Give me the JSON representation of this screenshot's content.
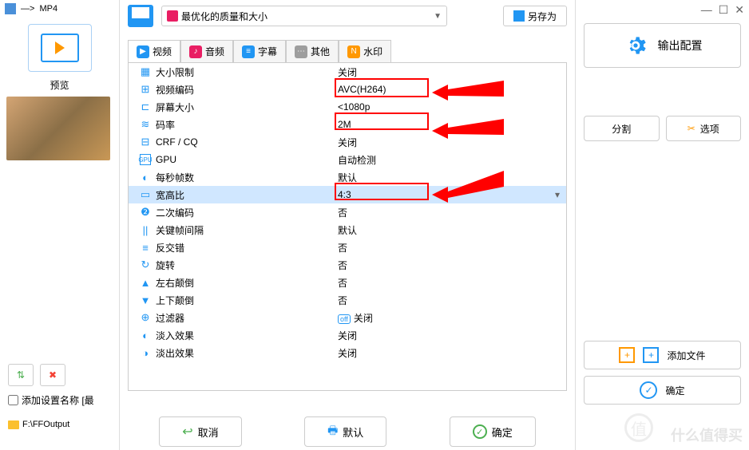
{
  "header": {
    "dest_format": "MP4",
    "arrow": "—>"
  },
  "left": {
    "preview_label": "预览",
    "tool1": "split-merge-icon",
    "tool2": "delete-icon",
    "checkbox_label": "添加设置名称 [最",
    "output_path": "F:\\FFOutput"
  },
  "preset": {
    "label": "最优化的质量和大小"
  },
  "buttons": {
    "save_as": "另存为",
    "cancel": "取消",
    "default": "默认",
    "ok": "确定"
  },
  "tabs": [
    {
      "label": "视频"
    },
    {
      "label": "音频"
    },
    {
      "label": "字幕"
    },
    {
      "label": "其他"
    },
    {
      "label": "水印"
    }
  ],
  "settings": [
    {
      "label": "大小限制",
      "value": "关闭"
    },
    {
      "label": "视频编码",
      "value": "AVC(H264)"
    },
    {
      "label": "屏幕大小",
      "value": "<1080p"
    },
    {
      "label": "码率",
      "value": "2M"
    },
    {
      "label": "CRF / CQ",
      "value": "关闭"
    },
    {
      "label": "GPU",
      "value": "自动检测"
    },
    {
      "label": "每秒帧数",
      "value": "默认"
    },
    {
      "label": "宽高比",
      "value": "4:3"
    },
    {
      "label": "二次编码",
      "value": "否"
    },
    {
      "label": "关键帧间隔",
      "value": "默认"
    },
    {
      "label": "反交错",
      "value": "否"
    },
    {
      "label": "旋转",
      "value": "否"
    },
    {
      "label": "左右颠倒",
      "value": "否"
    },
    {
      "label": "上下颠倒",
      "value": "否"
    },
    {
      "label": "过滤器",
      "value": "关闭"
    },
    {
      "label": "淡入效果",
      "value": "关闭"
    },
    {
      "label": "淡出效果",
      "value": "关闭"
    }
  ],
  "right": {
    "output_config": "输出配置",
    "split": "分割",
    "options": "选项",
    "add_files": "添加文件",
    "ok": "确定"
  },
  "watermark": "什么值得买"
}
